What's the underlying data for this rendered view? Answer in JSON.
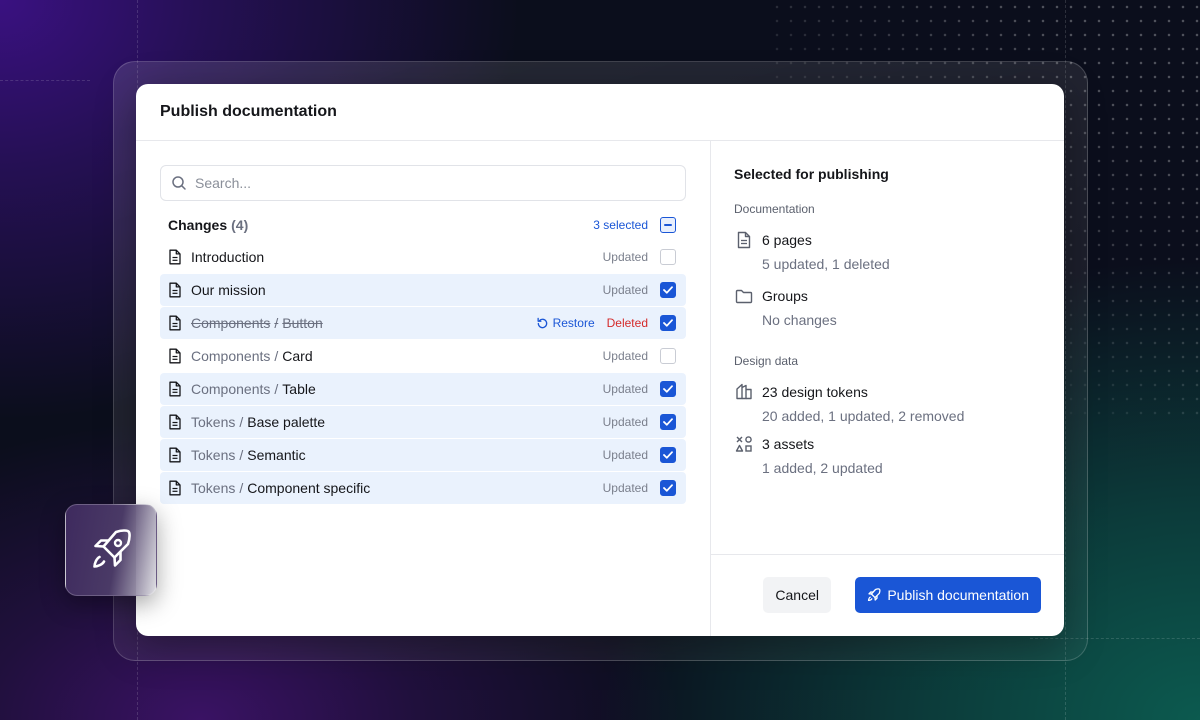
{
  "modal": {
    "title": "Publish documentation"
  },
  "search": {
    "placeholder": "Search...",
    "icon": "search-icon"
  },
  "changes": {
    "title": "Changes",
    "count": "(4)",
    "selected_label": "3 selected",
    "rows": [
      {
        "prefix": "",
        "name": "Introduction",
        "status": "Updated",
        "checked": false,
        "deleted": false
      },
      {
        "prefix": "",
        "name": "Our mission",
        "status": "Updated",
        "checked": true,
        "deleted": false
      },
      {
        "prefix": "Components",
        "name": "Button",
        "status": "Deleted",
        "checked": true,
        "deleted": true,
        "restore_label": "Restore"
      },
      {
        "prefix": "Components",
        "name": "Card",
        "status": "Updated",
        "checked": false,
        "deleted": false
      },
      {
        "prefix": "Components",
        "name": "Table",
        "status": "Updated",
        "checked": true,
        "deleted": false
      },
      {
        "prefix": "Tokens",
        "name": "Base palette",
        "status": "Updated",
        "checked": true,
        "deleted": false
      },
      {
        "prefix": "Tokens",
        "name": "Semantic",
        "status": "Updated",
        "checked": true,
        "deleted": false
      },
      {
        "prefix": "Tokens",
        "name": "Component specific",
        "status": "Updated",
        "checked": true,
        "deleted": false
      }
    ],
    "separator": "/"
  },
  "publishing": {
    "title": "Selected for publishing",
    "documentation_label": "Documentation",
    "pages": {
      "main": "6 pages",
      "sub": "5 updated, 1 deleted",
      "icon": "document-icon"
    },
    "groups": {
      "main": "Groups",
      "sub": "No changes",
      "icon": "folder-icon"
    },
    "design_label": "Design data",
    "tokens": {
      "main": "23 design tokens",
      "sub": "20 added, 1 updated, 2 removed",
      "icon": "tokens-icon"
    },
    "assets": {
      "main": "3 assets",
      "sub": "1 added, 2 updated",
      "icon": "shapes-icon"
    }
  },
  "footer": {
    "cancel_label": "Cancel",
    "publish_label": "Publish documentation"
  },
  "colors": {
    "accent": "#1a56d6",
    "deleted": "#d42a2a",
    "selected_row": "#eaf2fd"
  }
}
